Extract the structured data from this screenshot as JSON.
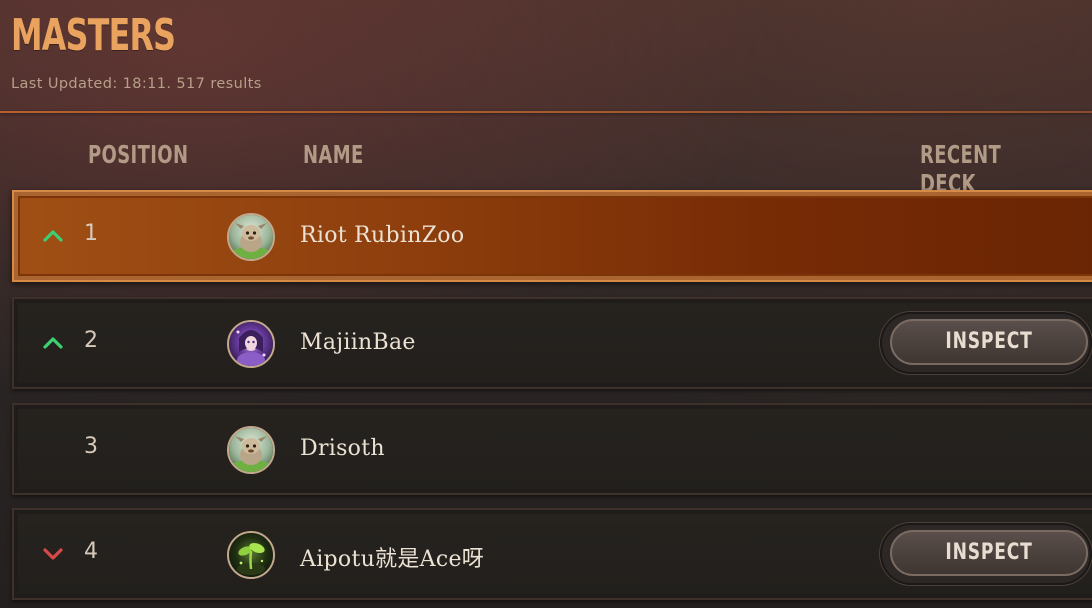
{
  "header": {
    "title": "MASTERS",
    "subtitle": "Last Updated: 18:11. 517 results"
  },
  "columns": {
    "position": "POSITION",
    "name": "NAME",
    "recent_deck": "RECENT DECK"
  },
  "rows": [
    {
      "position": "1",
      "name": "Riot RubinZoo",
      "trend": "up",
      "avatar": "poro-avatar",
      "inspect": ""
    },
    {
      "position": "2",
      "name": "MajiinBae",
      "trend": "up",
      "avatar": "purple-mage-avatar",
      "inspect": "INSPECT"
    },
    {
      "position": "3",
      "name": "Drisoth",
      "trend": "none",
      "avatar": "poro-avatar",
      "inspect": ""
    },
    {
      "position": "4",
      "name": "Aipotu就是Ace呀",
      "trend": "down",
      "avatar": "sprout-avatar",
      "inspect": "INSPECT"
    }
  ],
  "colors": {
    "title": "#e9a35f",
    "trend_up": "#3ccf74",
    "trend_down": "#d64a4a",
    "highlight_row": "#8f3f0d"
  }
}
